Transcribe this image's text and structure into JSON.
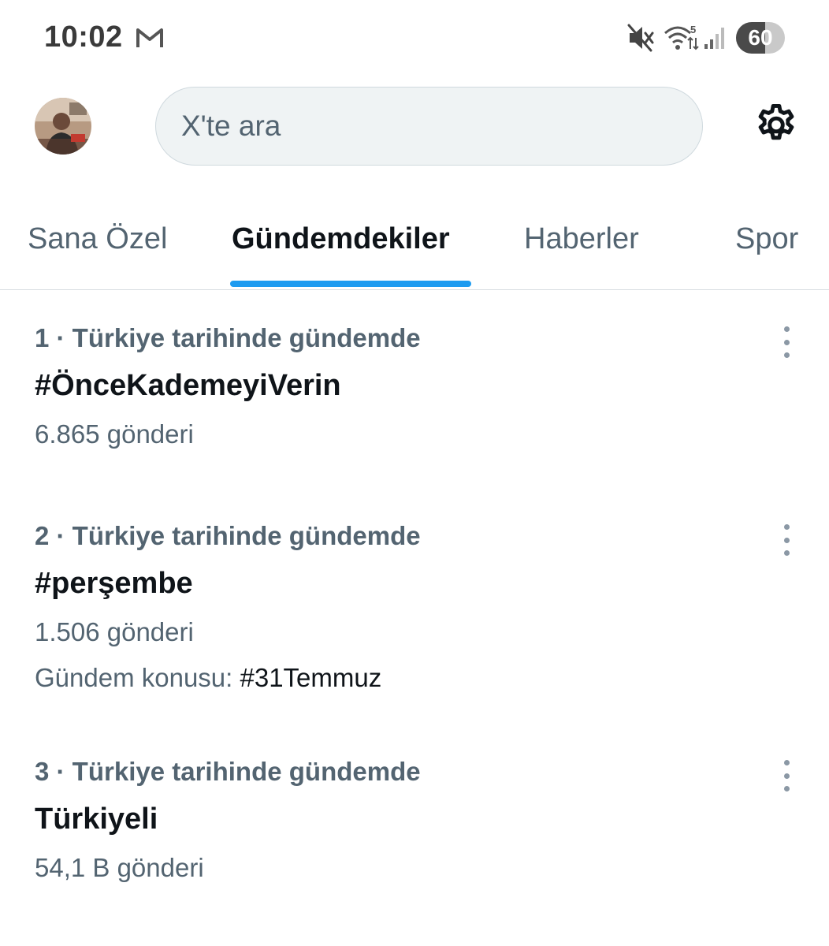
{
  "status_bar": {
    "time": "10:02",
    "battery_level": "60",
    "battery_fraction": 0.6,
    "icons": [
      "gmail-icon",
      "mute-icon",
      "wifi-icon",
      "signal-icon",
      "battery-icon"
    ]
  },
  "header": {
    "avatar_icon": "profile-avatar",
    "search_placeholder": "X'te ara",
    "settings_icon": "gear-icon"
  },
  "tabs": [
    {
      "label": "Sana Özel",
      "active": false
    },
    {
      "label": "Gündemdekiler",
      "active": true
    },
    {
      "label": "Haberler",
      "active": false
    },
    {
      "label": "Spor",
      "active": false
    }
  ],
  "colors": {
    "accent": "#1d9bf0",
    "text_primary": "#0f1419",
    "text_secondary": "#536471",
    "search_bg": "#eff3f4"
  },
  "trends": [
    {
      "meta": "1 · Türkiye tarihinde gündemde",
      "title": "#ÖnceKademeyiVerin",
      "count": "6.865 gönderi"
    },
    {
      "meta": "2 · Türkiye tarihinde gündemde",
      "title": "#perşembe",
      "count": "1.506 gönderi",
      "topic_label": "Gündem konusu: ",
      "topic_link": "#31Temmuz"
    },
    {
      "meta": "3 · Türkiye tarihinde gündemde",
      "title": "Türkiyeli",
      "count": "54,1 B gönderi"
    }
  ]
}
